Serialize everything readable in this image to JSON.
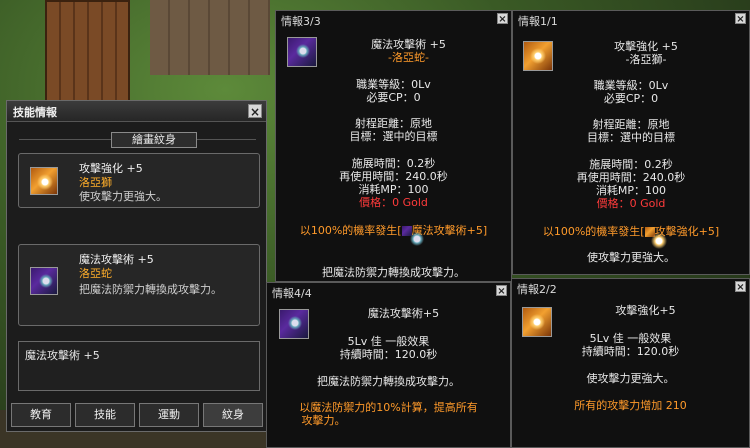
{
  "skill_window": {
    "title": "技能情報",
    "category": "繪畫紋身",
    "skills": [
      {
        "name": "攻擊強化 +5",
        "class": "洛亞獅",
        "desc": "使攻擊力更強大。",
        "icon": "attack-up-icon"
      },
      {
        "name": "魔法攻擊術 +5",
        "class": "洛亞蛇",
        "desc": "把魔法防禦力轉換成攻擊力。",
        "icon": "magic-attack-icon"
      }
    ],
    "note": "魔法攻擊術 +5",
    "tabs": [
      "教育",
      "技能",
      "運動",
      "紋身"
    ]
  },
  "info_3": {
    "header": "情報3/3",
    "title": "魔法攻擊術 +5",
    "class": "-洛亞蛇-",
    "job_level": "職業等級：0Lv",
    "cp": "必要CP：0",
    "range": "射程距離：原地",
    "target": "目標：選中的目標",
    "cast_time": "施展時間：0.2秒",
    "reuse_time": "再使用時間：240.0秒",
    "mp": "消耗MP：100",
    "price": "價格：0 Gold",
    "proc": "以100%的機率發生[",
    "proc_skill": "魔法攻擊術+5",
    "proc_end": "]",
    "effect": "把魔法防禦力轉換成攻擊力。"
  },
  "info_1": {
    "header": "情報1/1",
    "title": "攻擊強化 +5",
    "class": "-洛亞獅-",
    "job_level": "職業等級：0Lv",
    "cp": "必要CP：0",
    "range": "射程距離：原地",
    "target": "目標：選中的目標",
    "cast_time": "施展時間：0.2秒",
    "reuse_time": "再使用時間：240.0秒",
    "mp": "消耗MP：100",
    "price": "價格：0 Gold",
    "proc": "以100%的機率發生[",
    "proc_skill": "攻擊強化+5",
    "proc_end": "]",
    "effect": "使攻擊力更強大。"
  },
  "info_4": {
    "header": "情報4/4",
    "title": "魔法攻擊術+5",
    "level_line": "5Lv 佳 一般效果",
    "duration": "持續時間：120.0秒",
    "effect": "把魔法防禦力轉換成攻擊力。",
    "extra_1": "以魔法防禦力的10%計算，提高所有",
    "extra_2": "攻擊力。"
  },
  "info_2": {
    "header": "情報2/2",
    "title": "攻擊強化+5",
    "level_line": "5Lv 佳 一般效果",
    "duration": "持續時間：120.0秒",
    "effect": "使攻擊力更強大。",
    "extra_1": "所有的攻擊力增加 210"
  },
  "close_symbol": "×",
  "colors": {
    "accent_orange": "#ff9a2a",
    "price_red": "#ff3b3b",
    "window_bg": "#101010"
  }
}
